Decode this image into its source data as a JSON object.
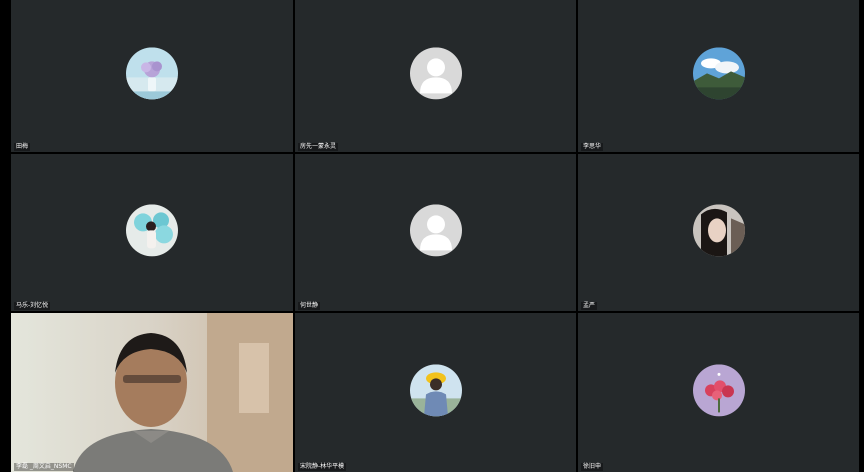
{
  "participants": [
    {
      "name": "田梅",
      "avatar": "flower-vase-photo-icon",
      "active": false
    },
    {
      "name": "房先一蒙永灵",
      "avatar": "default-user-icon",
      "active": false
    },
    {
      "name": "李思华",
      "avatar": "mountain-landscape-photo-icon",
      "active": false
    },
    {
      "name": "马乐-刘忆悦",
      "avatar": "blue-balloon-girl-photo-icon",
      "active": false
    },
    {
      "name": "何世静",
      "avatar": "default-user-icon",
      "active": false
    },
    {
      "name": "孟严",
      "avatar": "woman-portrait-photo-icon",
      "active": false
    },
    {
      "name": "李磊 _周文启_NSMC",
      "avatar": "live-camera-video",
      "active": true
    },
    {
      "name": "宋院静-林华平模",
      "avatar": "yellow-hat-child-photo-icon",
      "active": false
    },
    {
      "name": "徐旧申",
      "avatar": "pink-flowers-photo-icon",
      "active": false
    }
  ],
  "colors": {
    "tile_bg": "#25292b",
    "page_bg": "#000000",
    "active_border": "#3ddc7a"
  }
}
